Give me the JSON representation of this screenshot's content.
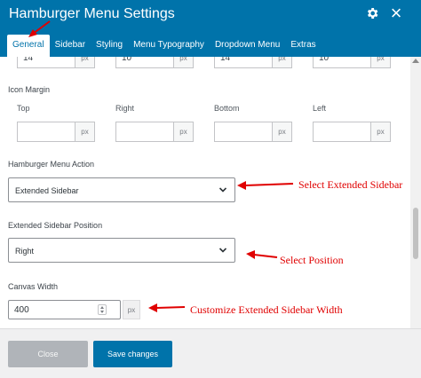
{
  "dialog": {
    "title": "Hamburger Menu Settings",
    "icons": {
      "settings": "gear-icon",
      "close": "close-icon"
    }
  },
  "tabs": [
    {
      "label": "General",
      "active": true
    },
    {
      "label": "Sidebar",
      "active": false
    },
    {
      "label": "Styling",
      "active": false
    },
    {
      "label": "Menu Typography",
      "active": false
    },
    {
      "label": "Dropdown Menu",
      "active": false
    },
    {
      "label": "Extras",
      "active": false
    }
  ],
  "top_row": {
    "values": [
      "14",
      "10",
      "14",
      "10"
    ],
    "unit": "px"
  },
  "icon_margin": {
    "label": "Icon Margin",
    "sides": [
      "Top",
      "Right",
      "Bottom",
      "Left"
    ],
    "values": [
      "",
      "",
      "",
      ""
    ],
    "unit": "px"
  },
  "menu_action": {
    "label": "Hamburger Menu Action",
    "selected": "Extended Sidebar"
  },
  "sidebar_position": {
    "label": "Extended Sidebar Position",
    "selected": "Right"
  },
  "canvas_width": {
    "label": "Canvas Width",
    "value": "400",
    "unit": "px"
  },
  "annotations": [
    "Select Extended Sidebar",
    "Select Position",
    "Customize Extended Sidebar Width"
  ],
  "footer": {
    "close_label": "Close",
    "save_label": "Save changes"
  },
  "colors": {
    "header": "#0073aa",
    "annotation": "#e00000",
    "save_button": "#0073aa",
    "close_button": "#b0b4b9"
  }
}
